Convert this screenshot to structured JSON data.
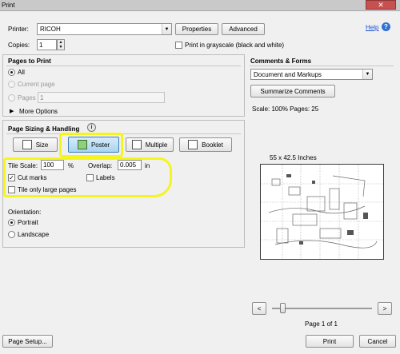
{
  "window": {
    "title": "Print",
    "close_icon": "close-icon"
  },
  "printer": {
    "label": "Printer:",
    "value": "RICOH",
    "properties_label": "Properties",
    "advanced_label": "Advanced",
    "help_label": "Help",
    "copies_label": "Copies:",
    "copies_value": "1",
    "grayscale_label": "Print in grayscale (black and white)"
  },
  "pages_to_print": {
    "heading": "Pages to Print",
    "all_label": "All",
    "current_label": "Current page",
    "pages_label": "Pages",
    "pages_value": "1",
    "more_options_label": "More Options"
  },
  "sizing": {
    "heading": "Page Sizing & Handling",
    "info_icon": "info-icon",
    "size_label": "Size",
    "poster_label": "Poster",
    "multiple_label": "Multiple",
    "booklet_label": "Booklet",
    "selected": "Poster"
  },
  "poster": {
    "tile_scale_label": "Tile Scale:",
    "tile_scale_value": "100",
    "tile_scale_unit": "%",
    "overlap_label": "Overlap:",
    "overlap_value": "0.005",
    "overlap_unit": "in",
    "cut_marks_label": "Cut marks",
    "cut_marks_checked": true,
    "labels_label": "Labels",
    "labels_checked": false,
    "tile_large_label": "Tile only large pages",
    "tile_large_checked": false,
    "highlight_color": "#f5f51e"
  },
  "orientation": {
    "heading": "Orientation:",
    "portrait_label": "Portrait",
    "landscape_label": "Landscape",
    "selected": "Portrait"
  },
  "comments_forms": {
    "heading": "Comments & Forms",
    "value": "Document and Markups",
    "summarize_label": "Summarize Comments"
  },
  "preview": {
    "scale_text": "Scale: 100% Pages: 25",
    "dimensions": "55 x 42.5 Inches",
    "prev_label": "<",
    "next_label": ">",
    "page_indicator": "Page 1 of 1"
  },
  "footer": {
    "page_setup_label": "Page Setup...",
    "print_label": "Print",
    "cancel_label": "Cancel"
  }
}
